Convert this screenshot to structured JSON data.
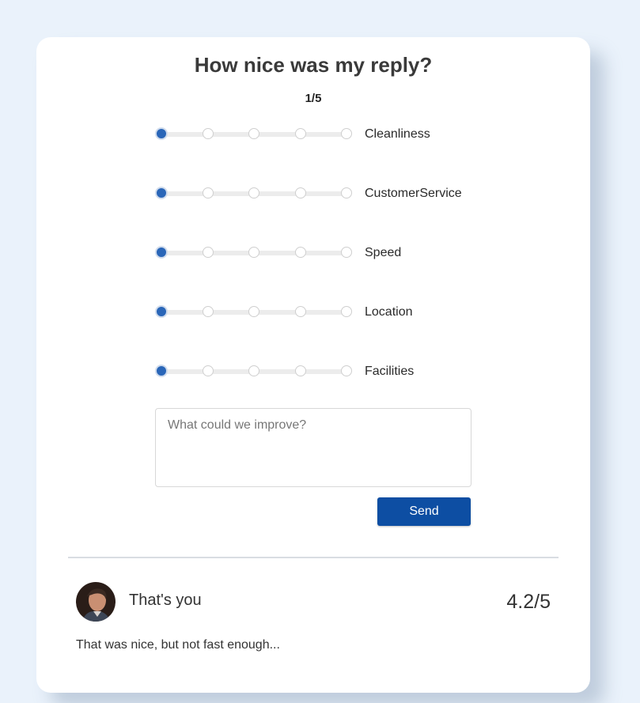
{
  "title": "How nice was my reply?",
  "step": "1/5",
  "ratings": [
    {
      "label": "Cleanliness",
      "value": 1,
      "max": 5
    },
    {
      "label": "CustomerService",
      "value": 1,
      "max": 5
    },
    {
      "label": "Speed",
      "value": 1,
      "max": 5
    },
    {
      "label": "Location",
      "value": 1,
      "max": 5
    },
    {
      "label": "Facilities",
      "value": 1,
      "max": 5
    }
  ],
  "feedback": {
    "placeholder": "What could we improve?",
    "value": ""
  },
  "send_label": "Send",
  "review": {
    "name": "That's you",
    "score": "4.2/5",
    "comment": "That was nice, but not fast enough..."
  },
  "colors": {
    "accent": "#0d4ea3",
    "selected_dot": "#2a66b8",
    "background": "#eaf2fb"
  }
}
